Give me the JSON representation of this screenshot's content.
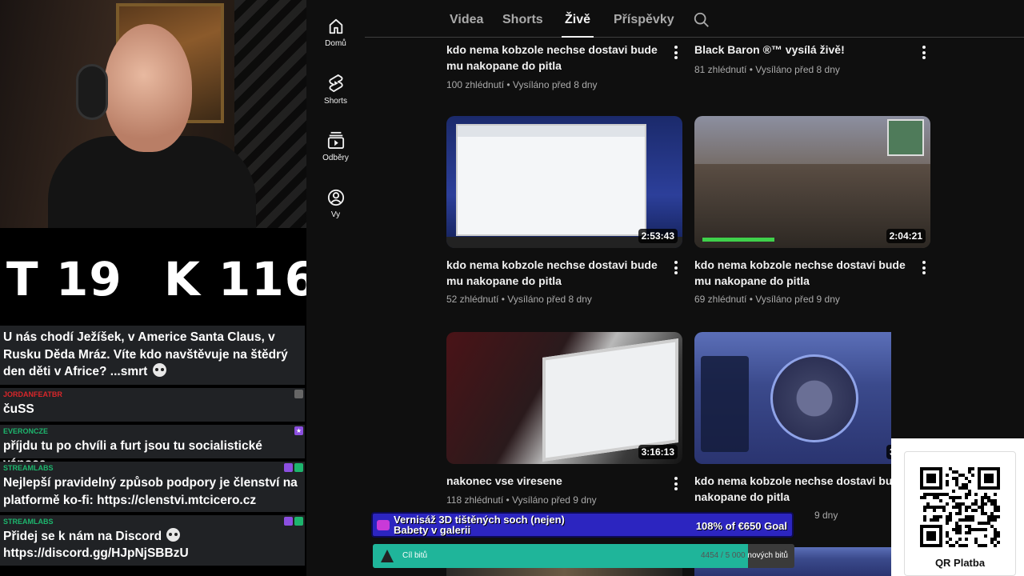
{
  "stream": {
    "stats": {
      "t_label": "T",
      "t_value": "19",
      "k_label": "K",
      "k_value": "116"
    }
  },
  "chat": {
    "messages": [
      {
        "user": "",
        "text": "U nás chodí Ježíšek, v Americe Santa Claus, v Rusku Děda Mráz. Víte kdo navštěvuje na štědrý den děti v Africe? ...smrt"
      },
      {
        "user": "JORDANFEATBR",
        "user_color": "#d9262a",
        "text": "čuSS"
      },
      {
        "user": "EVERONCZE",
        "user_color": "#1db56d",
        "text": "příjdu tu po chvíli a furt jsou tu socialistické vánoce"
      },
      {
        "user": "STREAMLABS",
        "user_color": "#1db56d",
        "text": "Nejlepší pravidelný způsob podpory je členství na platformě ko-fi: https://clenstvi.mtcicero.cz"
      },
      {
        "user": "STREAMLABS",
        "user_color": "#1db56d",
        "text": "Přidej se k nám na Discord",
        "text2": "https://discord.gg/HJpNjSBBzU"
      }
    ]
  },
  "rail": {
    "items": [
      {
        "label": "Domů",
        "icon": "home-icon"
      },
      {
        "label": "Shorts",
        "icon": "shorts-icon"
      },
      {
        "label": "Odběry",
        "icon": "subscriptions-icon"
      },
      {
        "label": "Vy",
        "icon": "you-icon"
      }
    ]
  },
  "tabs": {
    "items": [
      "Videa",
      "Shorts",
      "Živě",
      "Příspěvky"
    ],
    "active": "Živě"
  },
  "videos": [
    {
      "title": "kdo nema kobzole nechse dostavi bude mu nakopane do pitla",
      "meta": "100 zhlédnutí • Vysíláno před 8 dny"
    },
    {
      "title": "Black Baron ®™ vysílá živě!",
      "meta": "81 zhlédnutí • Vysíláno před 8 dny"
    },
    {
      "title": "kdo nema kobzole nechse dostavi bude mu nakopane do pitla",
      "meta": "52 zhlédnutí • Vysíláno před 8 dny",
      "duration": "2:53:43"
    },
    {
      "title": "kdo nema kobzole nechse dostavi bude mu nakopane do pitla",
      "meta": "69 zhlédnutí • Vysíláno před 9 dny",
      "duration": "2:04:21"
    },
    {
      "title": "nakonec vse viresene",
      "meta": "118 zhlédnutí • Vysíláno před 9 dny",
      "duration": "3:16:13"
    },
    {
      "title": "kdo nema kobzole nechse dostavi bude mu nakopane do pitla",
      "meta": "9 dny",
      "duration": "3"
    }
  ],
  "goal": {
    "text_line1": "Vernisáž 3D tištěných soch (nejen)",
    "text_line2": "Babety v galerii",
    "amount": "108% of €650 Goal"
  },
  "bits": {
    "label": "Cíl bitů",
    "current": "4454",
    "total": "5 000",
    "suffix": "nových bitů",
    "progress": 0.89
  },
  "qr": {
    "label": "QR Platba"
  }
}
